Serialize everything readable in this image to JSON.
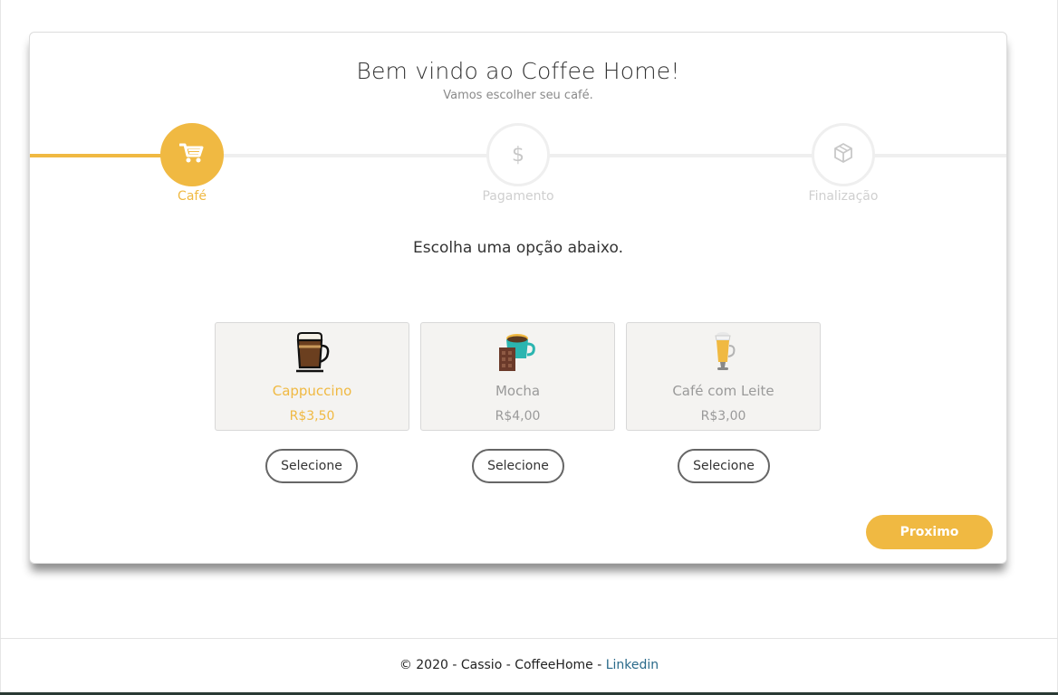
{
  "header": {
    "title": "Bem vindo ao Coffee Home!",
    "subtitle": "Vamos escolher seu café."
  },
  "progress": {
    "fill_fraction": 0.166,
    "steps": [
      {
        "label": "Café",
        "icon": "cart-icon",
        "active": true
      },
      {
        "label": "Pagamento",
        "icon": "dollar-icon",
        "active": false
      },
      {
        "label": "Finalização",
        "icon": "box-icon",
        "active": false
      }
    ]
  },
  "main": {
    "instruction": "Escolha uma opção abaixo.",
    "options": [
      {
        "name": "Cappuccino",
        "price": "R$3,50",
        "icon": "cappuccino-icon",
        "selected": true,
        "button_label": "Selecione"
      },
      {
        "name": "Mocha",
        "price": "R$4,00",
        "icon": "mocha-icon",
        "selected": false,
        "button_label": "Selecione"
      },
      {
        "name": "Café com Leite",
        "price": "R$3,00",
        "icon": "latte-icon",
        "selected": false,
        "button_label": "Selecione"
      }
    ],
    "next_label": "Proximo"
  },
  "dollar_glyph": "$",
  "footer": {
    "text": "© 2020 - Cassio - CoffeeHome - ",
    "link_label": "Linkedin"
  },
  "colors": {
    "accent": "#f0b942",
    "inactive": "#cfcfcf",
    "card_bg": "#f4f3f1",
    "link": "#2a6a8a"
  }
}
